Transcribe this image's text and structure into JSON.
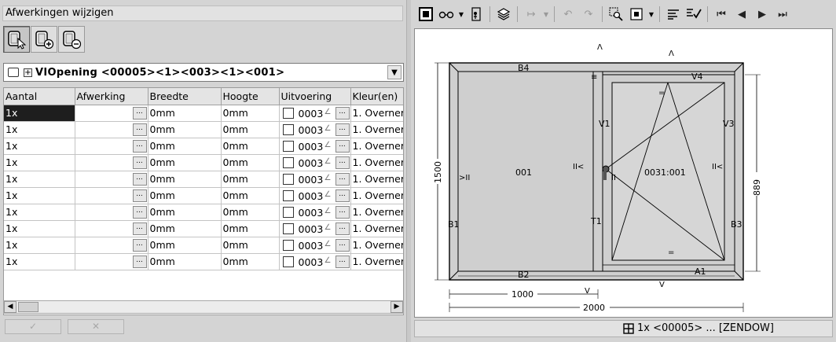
{
  "panel": {
    "title": "Afwerkingen wijzigen",
    "modes": [
      {
        "name": "select-mode-icon"
      },
      {
        "name": "add-mode-icon"
      },
      {
        "name": "remove-mode-icon"
      }
    ]
  },
  "selector": {
    "value": "VIOpening <00005><1><003><1><001>",
    "icon": "opening-icon"
  },
  "grid": {
    "columns": [
      "Aantal",
      "Afwerking",
      "Breedte",
      "Hoogte",
      "Uitvoering",
      "Kleur(en)"
    ],
    "rows": [
      {
        "aantal": "1x",
        "afwerking": "",
        "breedte": "0mm",
        "hoogte": "0mm",
        "uitvoering": "0003",
        "kleur": "1. Overner"
      },
      {
        "aantal": "1x",
        "afwerking": "",
        "breedte": "0mm",
        "hoogte": "0mm",
        "uitvoering": "0003",
        "kleur": "1. Overner"
      },
      {
        "aantal": "1x",
        "afwerking": "",
        "breedte": "0mm",
        "hoogte": "0mm",
        "uitvoering": "0003",
        "kleur": "1. Overner"
      },
      {
        "aantal": "1x",
        "afwerking": "",
        "breedte": "0mm",
        "hoogte": "0mm",
        "uitvoering": "0003",
        "kleur": "1. Overner"
      },
      {
        "aantal": "1x",
        "afwerking": "",
        "breedte": "0mm",
        "hoogte": "0mm",
        "uitvoering": "0003",
        "kleur": "1. Overner"
      },
      {
        "aantal": "1x",
        "afwerking": "",
        "breedte": "0mm",
        "hoogte": "0mm",
        "uitvoering": "0003",
        "kleur": "1. Overner"
      },
      {
        "aantal": "1x",
        "afwerking": "",
        "breedte": "0mm",
        "hoogte": "0mm",
        "uitvoering": "0003",
        "kleur": "1. Overner"
      },
      {
        "aantal": "1x",
        "afwerking": "",
        "breedte": "0mm",
        "hoogte": "0mm",
        "uitvoering": "0003",
        "kleur": "1. Overner"
      },
      {
        "aantal": "1x",
        "afwerking": "",
        "breedte": "0mm",
        "hoogte": "0mm",
        "uitvoering": "0003",
        "kleur": "1. Overner"
      },
      {
        "aantal": "1x",
        "afwerking": "",
        "breedte": "0mm",
        "hoogte": "0mm",
        "uitvoering": "0003",
        "kleur": "1. Overner"
      }
    ],
    "ellipsis": "..."
  },
  "buttons": {
    "ok_icon": "check-icon",
    "cancel_icon": "cross-icon"
  },
  "toolbar": {
    "items": [
      "frame-view-icon",
      "glasses-icon",
      "dropdown-icon",
      "figure-icon",
      "layers-icon",
      "dimension-icon",
      "dropdown-icon",
      "undo-icon",
      "redo-icon",
      "zoom-icon",
      "box-icon",
      "dropdown-icon",
      "align-icon",
      "check-edit-icon",
      "first-icon",
      "prev-icon",
      "next-icon",
      "last-icon"
    ]
  },
  "drawing": {
    "labels": {
      "b4": "B4",
      "v4": "V4",
      "v1": "V1",
      "v3": "V3",
      "b1": "B1",
      "b3": "B3",
      "t1": "T1",
      "b2": "B2",
      "a1": "A1",
      "left_pane": "001",
      "right_pane": "0031:001",
      "left_marker": ">II",
      "mid_marker_left": "II<",
      "mid_marker_right": "II",
      "right_marker": "II<"
    },
    "dimensions": {
      "total_height": "1500",
      "sash_height": "889",
      "left_width": "1000",
      "total_width": "2000"
    }
  },
  "status": {
    "text": "1x <00005> ... [ZENDOW]",
    "icon": "grid-icon"
  }
}
